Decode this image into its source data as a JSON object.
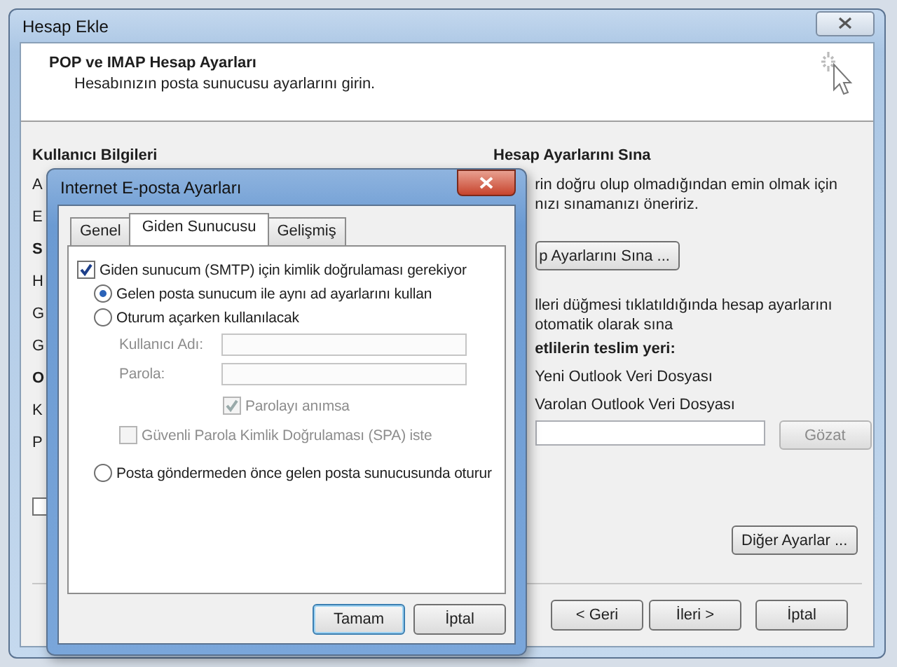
{
  "window": {
    "title": "Hesap Ekle"
  },
  "header": {
    "title": "POP ve IMAP Hesap Ayarları",
    "subtitle": "Hesabınızın posta sunucusu ayarlarını girin."
  },
  "left_section": {
    "heading": "Kullanıcı Bilgileri",
    "label_fragments": [
      {
        "text": "A",
        "kind": "label"
      },
      {
        "text": "E",
        "kind": "label"
      },
      {
        "text": "S",
        "kind": "heading"
      },
      {
        "text": "H",
        "kind": "label"
      },
      {
        "text": "G",
        "kind": "label"
      },
      {
        "text": "G",
        "kind": "label"
      },
      {
        "text": "O",
        "kind": "heading"
      },
      {
        "text": "K",
        "kind": "label"
      },
      {
        "text": "P",
        "kind": "label"
      }
    ],
    "checkbox": {
      "checked": false
    }
  },
  "right_section": {
    "heading": "Hesap Ayarlarını Sına",
    "description_lines": [
      "rin doğru olup olmadığından emin olmak için",
      "nızı sınamanızı öneririz."
    ],
    "test_button": "p Ayarlarını Sına ...",
    "auto_test_lines": [
      "lleri düğmesi tıklatıldığında hesap ayarlarını",
      "otomatik olarak sına"
    ],
    "delivery_label": "etlilerin teslim yeri:",
    "delivery_options": [
      "Yeni Outlook Veri Dosyası",
      "Varolan Outlook Veri Dosyası"
    ],
    "browse_button": "Gözat",
    "more_settings_button": "Diğer Ayarlar ..."
  },
  "footer_buttons": [
    "< Geri",
    "İleri >",
    "İptal"
  ],
  "dialog": {
    "title": "Internet E-posta Ayarları",
    "tabs": [
      {
        "label": "Genel",
        "selected": false
      },
      {
        "label": "Giden Sunucusu",
        "selected": true
      },
      {
        "label": "Gelişmiş",
        "selected": false
      }
    ],
    "options": [
      {
        "kind": "checkbox",
        "label": "Giden sunucum (SMTP) için kimlik doğrulaması gerekiyor",
        "checked": true,
        "disabled": false,
        "children": [
          {
            "kind": "radio",
            "label": "Gelen posta sunucum ile aynı ad ayarlarını kullan",
            "selected": true,
            "disabled": false
          },
          {
            "kind": "radio",
            "label": "Oturum açarken kullanılacak",
            "selected": false,
            "disabled": false,
            "children": [
              {
                "kind": "field",
                "label": "Kullanıcı Adı:",
                "disabled": true
              },
              {
                "kind": "field",
                "label": "Parola:",
                "disabled": true,
                "children": [
                  {
                    "kind": "checkbox",
                    "label": "Parolayı anımsa",
                    "checked": true,
                    "disabled": true
                  }
                ]
              },
              {
                "kind": "checkbox",
                "label": "Güvenli Parola Kimlik Doğrulaması (SPA) iste",
                "checked": false,
                "disabled": true
              }
            ]
          },
          {
            "kind": "radio",
            "label": "Posta göndermeden önce gelen posta sunucusunda oturur",
            "selected": false,
            "disabled": false
          }
        ]
      }
    ],
    "buttons": [
      "Tamam",
      "İptal"
    ]
  }
}
